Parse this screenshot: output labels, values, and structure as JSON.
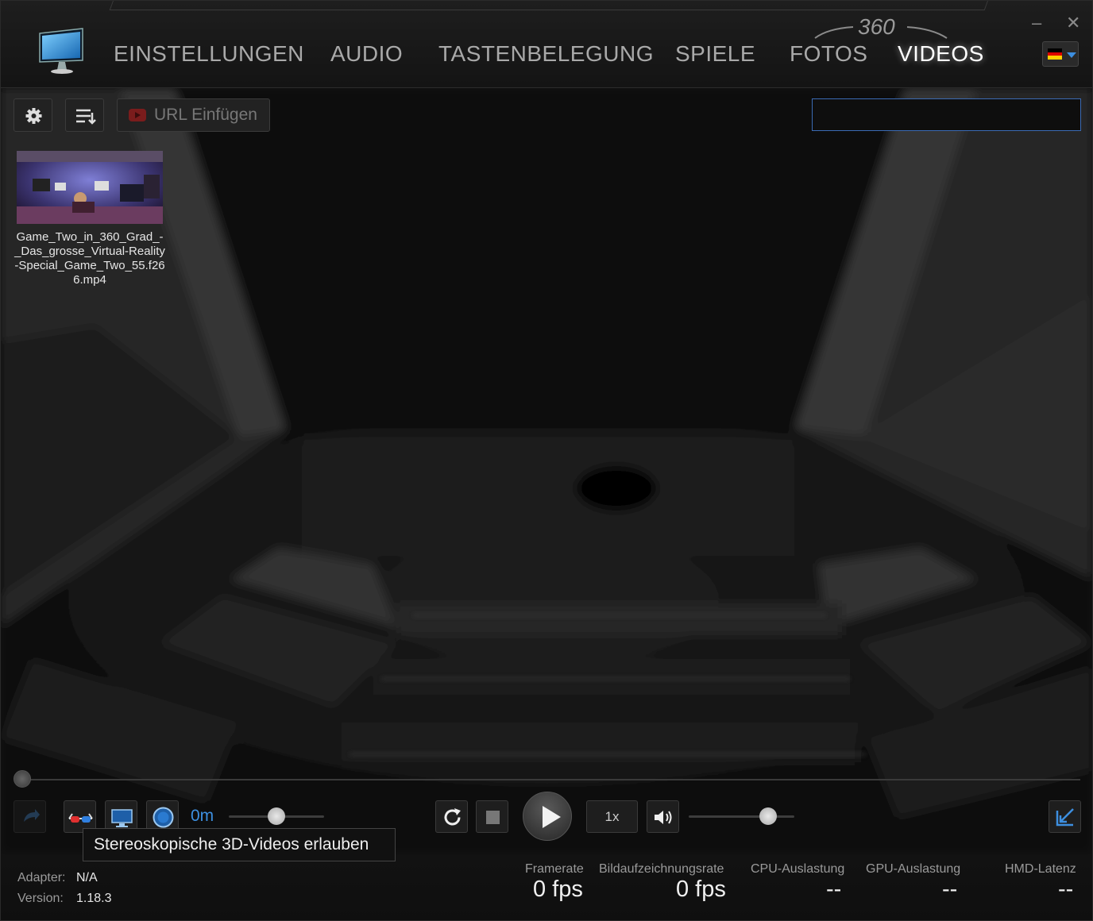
{
  "nav": {
    "items": [
      "EINSTELLUNGEN",
      "AUDIO",
      "TASTENBELEGUNG",
      "SPIELE",
      "FOTOS",
      "VIDEOS"
    ],
    "active": "VIDEOS",
    "badge": "360",
    "language": "DE"
  },
  "toolbar": {
    "url_button": "URL Einfügen",
    "search_value": ""
  },
  "library": {
    "items": [
      {
        "name": "Game_Two_in_360_Grad_-_Das_grosse_Virtual-Reality-Special_Game_Two_55.f266.mp4"
      }
    ]
  },
  "player": {
    "distance": "0m",
    "speed": "1x",
    "seek_position": 0,
    "distance_level": 0.5,
    "volume_level": 0.75
  },
  "tooltip": {
    "text": "Stereoskopische 3D-Videos erlauben"
  },
  "status": {
    "adapter_label": "Adapter:",
    "adapter_value": "N/A",
    "version_label": "Version:",
    "version_value": "1.18.3",
    "metrics": [
      {
        "label": "Framerate",
        "value": "0 fps"
      },
      {
        "label": "Bildaufzeichnungsrate",
        "value": "0 fps"
      },
      {
        "label": "CPU-Auslastung",
        "value": "--"
      },
      {
        "label": "GPU-Auslastung",
        "value": "--"
      },
      {
        "label": "HMD-Latenz",
        "value": "--"
      }
    ]
  },
  "colors": {
    "accent": "#3d8fe0",
    "background": "#0c0c0c",
    "header": "#1a1a1a"
  }
}
